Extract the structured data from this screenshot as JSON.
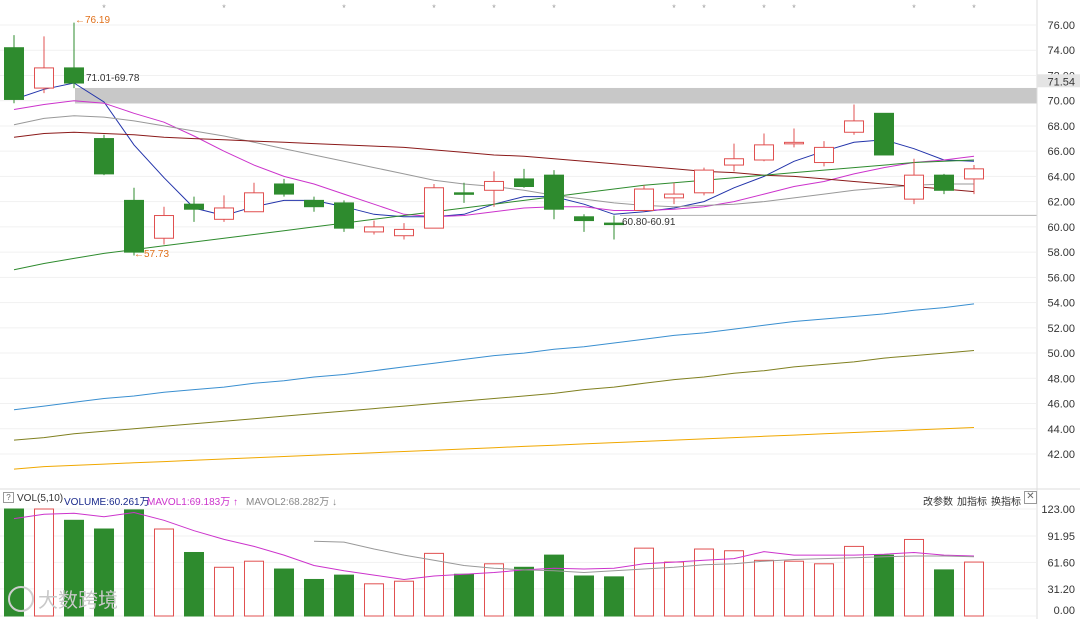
{
  "chart_data": [
    {
      "type": "candlestick",
      "ylim": [
        40.5,
        77.5
      ],
      "y_ticks": [
        "76.00",
        "74.00",
        "72.00",
        "70.00",
        "68.00",
        "66.00",
        "64.00",
        "62.00",
        "60.00",
        "58.00",
        "56.00",
        "54.00",
        "52.00",
        "50.00",
        "48.00",
        "46.00",
        "44.00",
        "42.00"
      ],
      "last_price_label": "71.54",
      "annotations": {
        "high": "←76.19",
        "low": "←57.73",
        "gap_upper": "71.01-69.78",
        "gap_lower": "60.80-60.91"
      },
      "gap_band": [
        69.78,
        71.01
      ],
      "reference_line": 60.91,
      "candles": [
        {
          "o": 74.2,
          "c": 70.1,
          "h": 75.2,
          "l": 69.8
        },
        {
          "o": 71.0,
          "c": 72.6,
          "h": 75.1,
          "l": 70.6
        },
        {
          "o": 72.6,
          "c": 71.4,
          "h": 76.19,
          "l": 71.0
        },
        {
          "o": 67.0,
          "c": 64.2,
          "h": 67.3,
          "l": 64.1
        },
        {
          "o": 62.1,
          "c": 58.0,
          "h": 63.1,
          "l": 57.73
        },
        {
          "o": 59.1,
          "c": 60.9,
          "h": 61.6,
          "l": 58.6
        },
        {
          "o": 61.8,
          "c": 61.4,
          "h": 62.4,
          "l": 60.4
        },
        {
          "o": 60.6,
          "c": 61.5,
          "h": 62.5,
          "l": 60.4
        },
        {
          "o": 61.2,
          "c": 62.7,
          "h": 63.5,
          "l": 61.2
        },
        {
          "o": 63.4,
          "c": 62.6,
          "h": 63.8,
          "l": 62.4
        },
        {
          "o": 62.1,
          "c": 61.6,
          "h": 62.4,
          "l": 61.2
        },
        {
          "o": 61.9,
          "c": 59.9,
          "h": 62.1,
          "l": 59.6
        },
        {
          "o": 59.6,
          "c": 60.0,
          "h": 60.5,
          "l": 59.4
        },
        {
          "o": 59.3,
          "c": 59.8,
          "h": 60.3,
          "l": 59.0
        },
        {
          "o": 59.9,
          "c": 63.1,
          "h": 63.4,
          "l": 59.9
        },
        {
          "o": 62.7,
          "c": 62.6,
          "h": 63.5,
          "l": 61.9
        },
        {
          "o": 62.9,
          "c": 63.6,
          "h": 64.4,
          "l": 61.6
        },
        {
          "o": 63.8,
          "c": 63.2,
          "h": 64.6,
          "l": 63.1
        },
        {
          "o": 64.1,
          "c": 61.4,
          "h": 64.5,
          "l": 60.6
        },
        {
          "o": 60.8,
          "c": 60.5,
          "h": 61.0,
          "l": 59.6
        },
        {
          "o": 60.3,
          "c": 60.2,
          "h": 60.9,
          "l": 59.0
        },
        {
          "o": 61.3,
          "c": 63.0,
          "h": 63.3,
          "l": 61.2
        },
        {
          "o": 62.3,
          "c": 62.6,
          "h": 63.5,
          "l": 61.8
        },
        {
          "o": 62.7,
          "c": 64.5,
          "h": 64.7,
          "l": 62.5
        },
        {
          "o": 64.9,
          "c": 65.4,
          "h": 66.6,
          "l": 64.4
        },
        {
          "o": 65.3,
          "c": 66.5,
          "h": 67.4,
          "l": 65.2
        },
        {
          "o": 66.6,
          "c": 66.7,
          "h": 67.8,
          "l": 66.3
        },
        {
          "o": 65.1,
          "c": 66.3,
          "h": 66.8,
          "l": 64.8
        },
        {
          "o": 67.5,
          "c": 68.4,
          "h": 69.7,
          "l": 67.3
        },
        {
          "o": 69.0,
          "c": 65.7,
          "h": 69.0,
          "l": 65.7
        },
        {
          "o": 62.2,
          "c": 64.1,
          "h": 65.4,
          "l": 61.8
        },
        {
          "o": 64.1,
          "c": 62.9,
          "h": 64.2,
          "l": 62.6
        },
        {
          "o": 63.8,
          "c": 64.6,
          "h": 64.9,
          "l": 62.6
        }
      ],
      "series": [
        {
          "color": "#2233aa",
          "values": [
            70.1,
            70.9,
            71.4,
            69.9,
            66.5,
            63.9,
            61.5,
            60.9,
            61.6,
            62.1,
            62.1,
            61.6,
            61.0,
            60.8,
            60.8,
            61.0,
            61.8,
            62.4,
            62.4,
            61.8,
            61.0,
            61.2,
            61.5,
            62.0,
            63.1,
            64.0,
            65.2,
            66.0,
            66.7,
            66.9,
            66.2,
            65.3,
            65.2
          ]
        },
        {
          "color": "#cc33cc",
          "values": [
            69.3,
            69.7,
            70.0,
            69.8,
            69.0,
            68.3,
            67.2,
            66.0,
            64.9,
            64.0,
            63.4,
            62.6,
            61.8,
            61.0,
            60.8,
            60.9,
            61.2,
            61.5,
            61.6,
            61.6,
            61.3,
            61.3,
            61.4,
            61.6,
            62.0,
            62.6,
            63.2,
            63.6,
            64.2,
            64.7,
            65.1,
            65.3,
            65.6
          ]
        },
        {
          "color": "#999999",
          "values": [
            68.1,
            68.6,
            68.8,
            68.7,
            68.4,
            68.0,
            67.6,
            67.2,
            66.7,
            66.2,
            65.7,
            65.2,
            64.7,
            64.2,
            63.7,
            63.4,
            63.2,
            62.9,
            62.5,
            62.2,
            61.9,
            61.7,
            61.6,
            61.7,
            61.8,
            62.0,
            62.3,
            62.6,
            62.9,
            63.1,
            63.3,
            63.4,
            63.4
          ]
        },
        {
          "color": "#8b1a1a",
          "values": [
            67.1,
            67.4,
            67.5,
            67.4,
            67.3,
            67.1,
            67.0,
            66.9,
            66.8,
            66.7,
            66.6,
            66.5,
            66.4,
            66.3,
            66.1,
            65.9,
            65.7,
            65.6,
            65.4,
            65.2,
            65.0,
            64.8,
            64.6,
            64.4,
            64.3,
            64.1,
            64.0,
            63.8,
            63.6,
            63.4,
            63.2,
            63.0,
            62.8
          ]
        },
        {
          "color": "#2e8b2e",
          "values": [
            56.6,
            57.1,
            57.5,
            57.9,
            58.2,
            58.5,
            58.8,
            59.1,
            59.4,
            59.7,
            60.0,
            60.3,
            60.6,
            60.9,
            61.2,
            61.5,
            61.8,
            62.1,
            62.4,
            62.7,
            63.0,
            63.3,
            63.5,
            63.7,
            63.9,
            64.1,
            64.3,
            64.5,
            64.7,
            64.9,
            65.1,
            65.2,
            65.3
          ]
        },
        {
          "color": "#3a8fd0",
          "values": [
            45.5,
            45.8,
            46.1,
            46.4,
            46.6,
            46.9,
            47.1,
            47.3,
            47.6,
            47.8,
            48.1,
            48.3,
            48.6,
            48.9,
            49.2,
            49.5,
            49.8,
            50.0,
            50.3,
            50.5,
            50.8,
            51.1,
            51.4,
            51.6,
            51.9,
            52.2,
            52.5,
            52.7,
            52.9,
            53.1,
            53.4,
            53.6,
            53.9
          ]
        },
        {
          "color": "#808020",
          "values": [
            43.1,
            43.3,
            43.6,
            43.8,
            44.0,
            44.2,
            44.4,
            44.6,
            44.8,
            45.0,
            45.2,
            45.4,
            45.6,
            45.8,
            46.0,
            46.2,
            46.4,
            46.6,
            46.8,
            47.1,
            47.3,
            47.6,
            47.9,
            48.1,
            48.4,
            48.6,
            48.9,
            49.1,
            49.3,
            49.6,
            49.8,
            50.0,
            50.2
          ]
        },
        {
          "color": "#f0a800",
          "values": [
            40.8,
            41.0,
            41.1,
            41.2,
            41.3,
            41.4,
            41.5,
            41.6,
            41.7,
            41.8,
            41.9,
            42.0,
            42.1,
            42.2,
            42.3,
            42.4,
            42.5,
            42.6,
            42.7,
            42.8,
            42.9,
            43.0,
            43.1,
            43.2,
            43.3,
            43.4,
            43.5,
            43.6,
            43.7,
            43.8,
            43.9,
            44.0,
            44.1
          ]
        }
      ]
    },
    {
      "type": "bar",
      "ylim": [
        0,
        123
      ],
      "y_ticks": [
        "123.00",
        "91.95",
        "61.60",
        "31.20",
        "0.00"
      ],
      "legend": {
        "label": "VOL(5,10)",
        "volume": "VOLUME:60.261万",
        "mavol1": "MAVOL1:69.183万 ↑",
        "mavol2": "MAVOL2:68.282万 ↓"
      },
      "values": [
        123,
        123,
        110,
        100,
        122,
        100,
        73,
        56,
        63,
        54,
        42,
        47,
        37,
        40,
        72,
        48,
        60,
        56,
        70,
        46,
        45,
        78,
        62,
        77,
        75,
        64,
        63,
        60,
        80,
        70,
        88,
        53,
        62
      ],
      "series": [
        {
          "name": "MAVOL1",
          "color": "#cc33cc",
          "values": [
            112,
            117,
            118,
            114,
            119,
            110,
            98,
            88,
            80,
            70,
            58,
            52,
            47,
            42,
            46,
            48,
            50,
            53,
            55,
            54,
            55,
            60,
            62,
            64,
            66,
            74,
            70,
            70,
            70,
            71,
            73,
            70,
            69
          ]
        },
        {
          "name": "MAVOL2",
          "color": "#999999",
          "values": [
            null,
            null,
            null,
            null,
            null,
            null,
            null,
            null,
            null,
            null,
            86,
            85,
            77,
            70,
            64,
            58,
            55,
            53,
            52,
            50,
            52,
            54,
            56,
            59,
            60,
            63,
            65,
            66,
            67,
            68,
            69,
            69,
            68
          ]
        }
      ]
    }
  ],
  "toolbar": {
    "help": "?",
    "modify_params": "改参数",
    "add_indicator": "加指标",
    "switch_indicator": "换指标",
    "close": "✕"
  },
  "watermark": "大数跨境"
}
